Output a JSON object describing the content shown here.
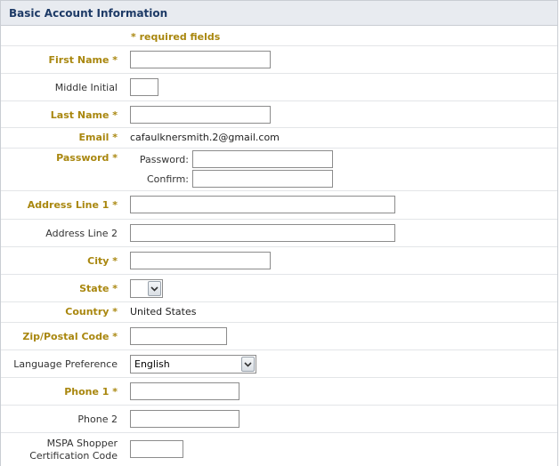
{
  "header": {
    "title": "Basic Account Information"
  },
  "required_note": "* required fields",
  "fields": {
    "first_name": {
      "label": "First Name *",
      "value": ""
    },
    "middle_initial": {
      "label": "Middle Initial",
      "value": ""
    },
    "last_name": {
      "label": "Last Name *",
      "value": ""
    },
    "email": {
      "label": "Email *",
      "value": "cafaulknersmith.2@gmail.com"
    },
    "password": {
      "label": "Password *",
      "password_label": "Password:",
      "confirm_label": "Confirm:",
      "password_value": "",
      "confirm_value": ""
    },
    "address1": {
      "label": "Address Line 1 *",
      "value": ""
    },
    "address2": {
      "label": "Address Line 2",
      "value": ""
    },
    "city": {
      "label": "City *",
      "value": ""
    },
    "state": {
      "label": "State *",
      "value": ""
    },
    "country": {
      "label": "Country *",
      "value": "United States"
    },
    "zip": {
      "label": "Zip/Postal Code *",
      "value": ""
    },
    "language": {
      "label": "Language Preference",
      "value": "English"
    },
    "phone1": {
      "label": "Phone 1 *",
      "value": ""
    },
    "phone2": {
      "label": "Phone 2",
      "value": ""
    },
    "mspa": {
      "label_line1": "MSPA Shopper",
      "label_line2": "Certification Code",
      "value": ""
    }
  },
  "colors": {
    "required": "#a9870f",
    "header_bg": "#e8ebf0",
    "header_text": "#1d3a66"
  },
  "icons": {
    "dropdown": "chevron-down-icon"
  }
}
